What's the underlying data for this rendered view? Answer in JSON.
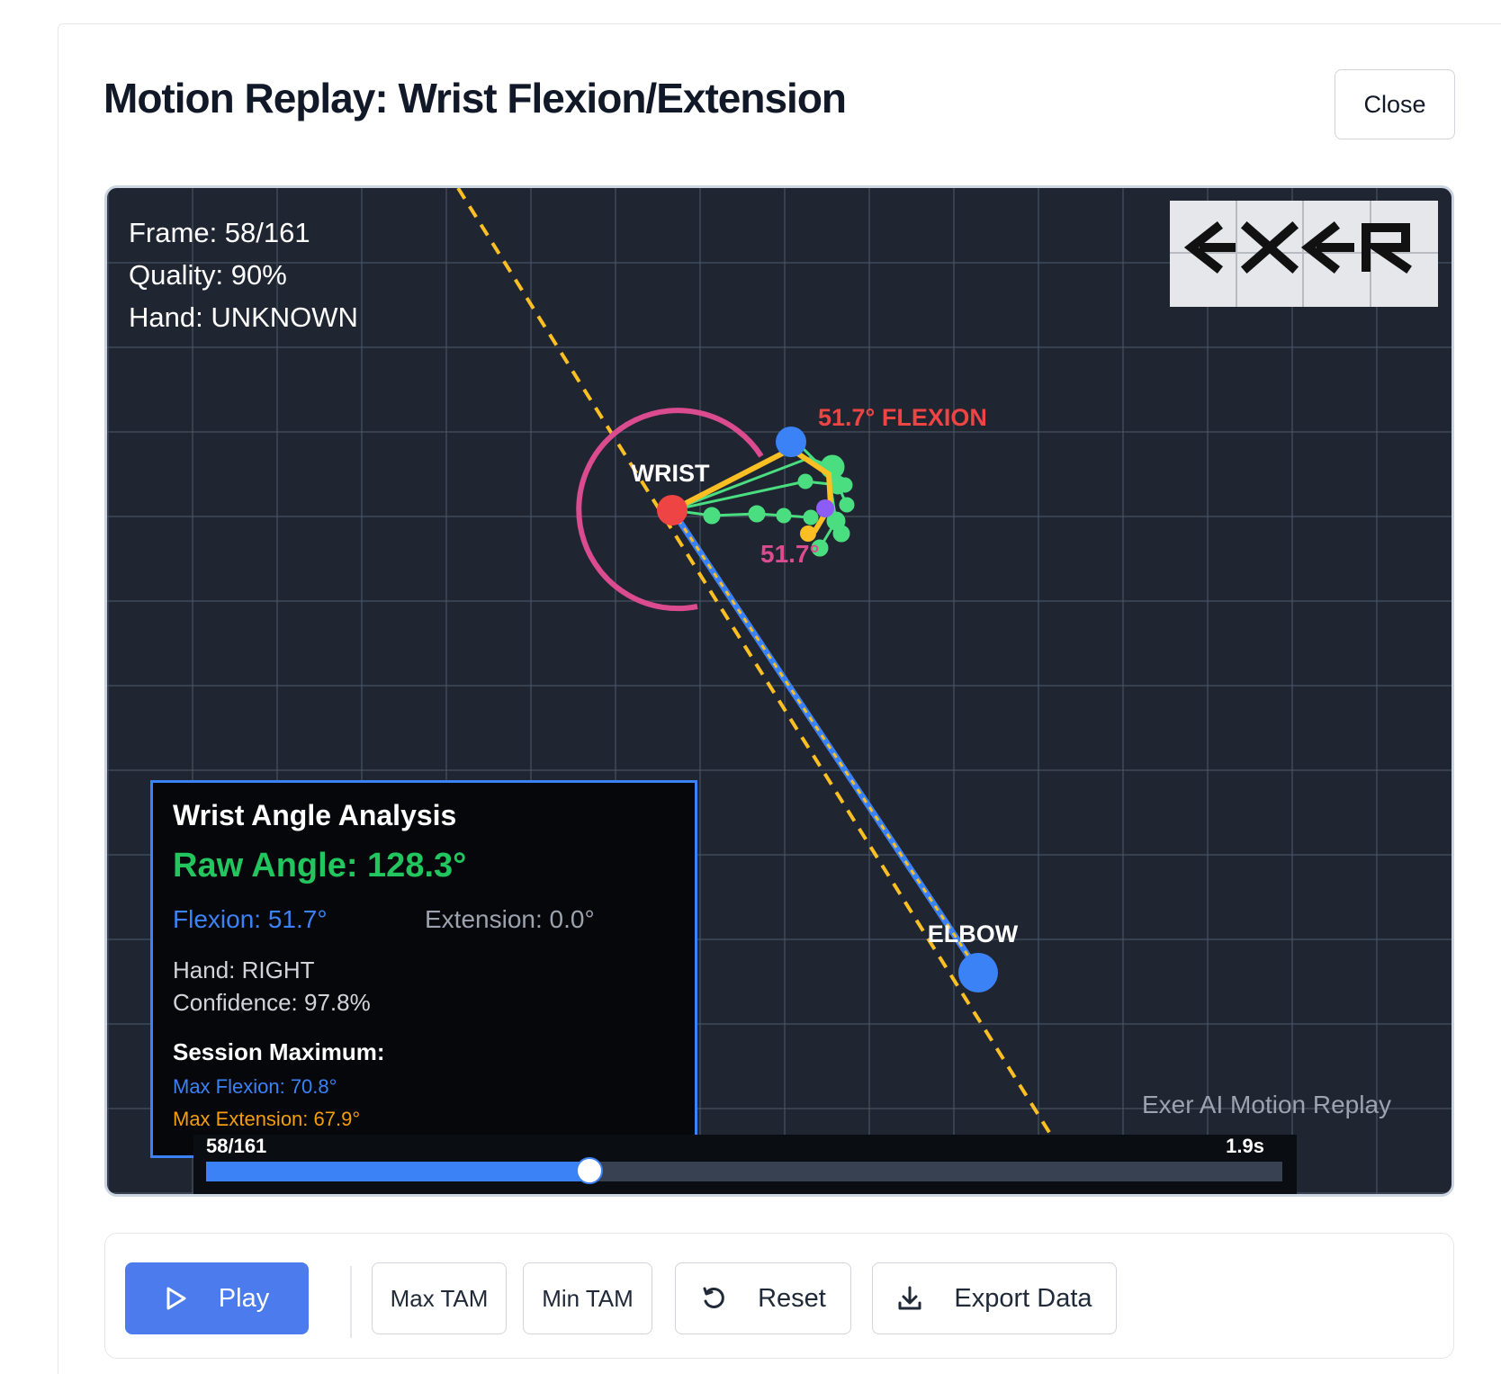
{
  "dialog": {
    "title": "Motion Replay: Wrist Flexion/Extension",
    "close_label": "Close"
  },
  "viewer": {
    "frame_text": "Frame: 58/161",
    "quality_text": "Quality: 90%",
    "hand_text": "Hand: UNKNOWN",
    "logo_alt": "EXER",
    "labels": {
      "wrist": "WRIST",
      "elbow": "ELBOW",
      "flexion_label": "51.7° FLEXION",
      "arc_angle": "51.7°"
    },
    "analysis": {
      "title": "Wrist Angle Analysis",
      "raw_angle": "Raw Angle: 128.3°",
      "flexion": "Flexion: 51.7°",
      "extension": "Extension: 0.0°",
      "hand": "Hand: RIGHT",
      "confidence": "Confidence: 97.8%",
      "session_max_title": "Session Maximum:",
      "max_flexion": "Max Flexion: 70.8°",
      "max_extension": "Max Extension: 67.9°"
    },
    "watermark": "Exer AI Motion Replay",
    "timeline": {
      "frame": "58/161",
      "time": "1.9s",
      "progress": 0.356
    },
    "colors": {
      "background": "#1f2531",
      "wrist_joint": "#ef4444",
      "elbow_joint": "#3b82f6",
      "arc": "#db4b8f",
      "flexion_text": "#ef4444",
      "reference_line": "#fbbf24",
      "hand_skeleton": "#4ade80",
      "thumb_segment": "#fbbf24"
    }
  },
  "controls": {
    "play_label": "Play",
    "max_tam_label": "Max TAM",
    "min_tam_label": "Min TAM",
    "reset_label": "Reset",
    "export_label": "Export Data",
    "icons": {
      "play": "play-icon",
      "reset": "reset-icon",
      "export": "download-icon"
    }
  }
}
